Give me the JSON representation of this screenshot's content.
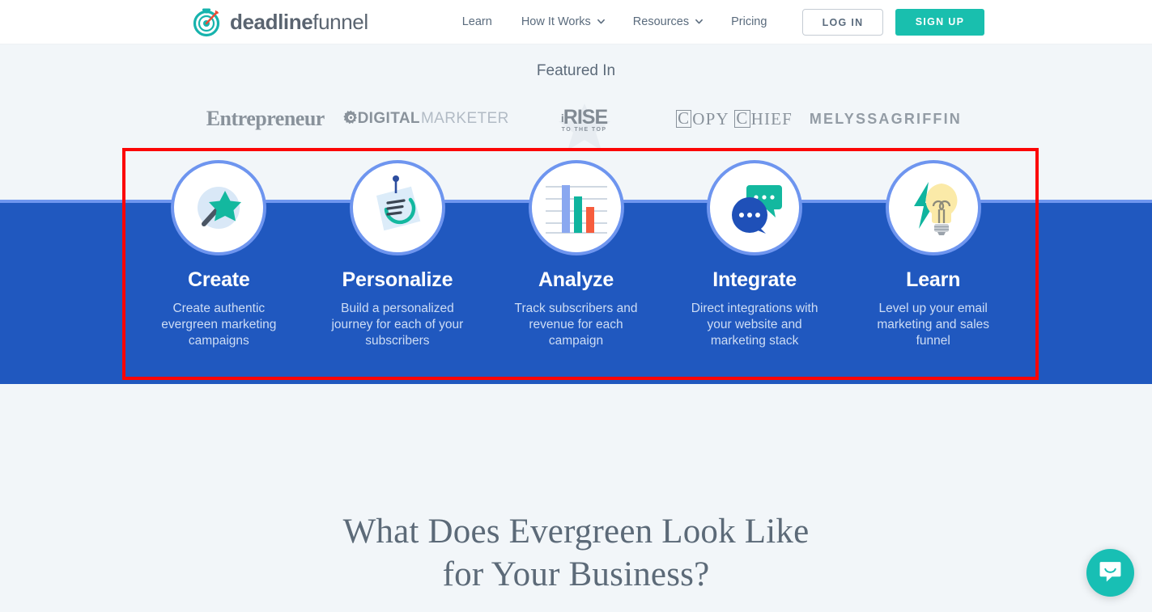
{
  "header": {
    "logo": {
      "icon": "stopwatch-target-icon",
      "text_bold": "deadline",
      "text_light": "funnel"
    },
    "nav": [
      {
        "label": "Learn",
        "has_caret": false
      },
      {
        "label": "How It Works",
        "has_caret": true
      },
      {
        "label": "Resources",
        "has_caret": true
      },
      {
        "label": "Pricing",
        "has_caret": false
      }
    ],
    "login_label": "LOG IN",
    "signup_label": "SIGN UP",
    "signup_color": "#19bfae"
  },
  "featured": {
    "title": "Featured In",
    "logos": [
      {
        "name": "entrepreneur-logo",
        "text": "Entrepreneur"
      },
      {
        "name": "digitalmarketer-logo",
        "text_bold": "DIGITAL",
        "text_light": "MARKETER"
      },
      {
        "name": "rise-to-the-top-logo",
        "text": "RISE",
        "prefix": "i",
        "tagline": "TO THE TOP"
      },
      {
        "name": "copy-chief-logo",
        "word1_first": "C",
        "word1_rest": "OPY",
        "word2_first": "C",
        "word2_rest": "HIEF"
      },
      {
        "name": "melyssa-griffin-logo",
        "text": "MELYSSAGRIFFIN"
      }
    ]
  },
  "band": {
    "background": "#2058bf",
    "top_border": "#6e95ef",
    "highlight_color": "#fc0505"
  },
  "features": [
    {
      "icon": "magic-wand-icon",
      "title": "Create",
      "desc": "Create authentic evergreen marketing campaigns"
    },
    {
      "icon": "pinned-note-icon",
      "title": "Personalize",
      "desc": "Build a personalized journey for each of your subscribers"
    },
    {
      "icon": "bar-chart-icon",
      "title": "Analyze",
      "desc": "Track subscribers and revenue for each campaign"
    },
    {
      "icon": "chat-bubbles-icon",
      "title": "Integrate",
      "desc": "Direct integrations with your website and marketing stack"
    },
    {
      "icon": "lightbulb-bolt-icon",
      "title": "Learn",
      "desc": "Level up your email marketing and sales funnel"
    }
  ],
  "bottom": {
    "headline_line1": "What Does Evergreen Look Like",
    "headline_line2": "for Your Business?"
  },
  "intercom": {
    "icon": "chat-smile-icon",
    "color": "#18bfb4"
  }
}
